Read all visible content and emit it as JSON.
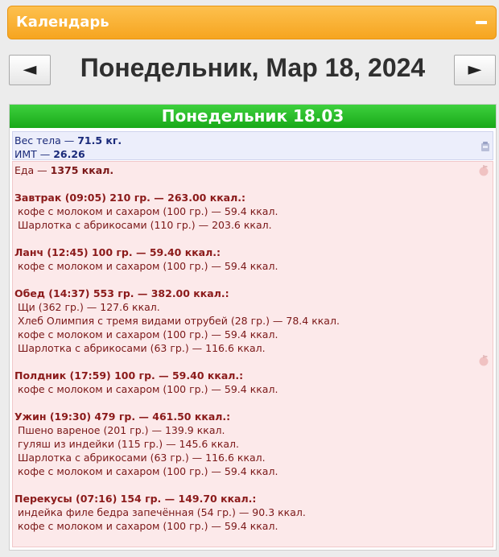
{
  "header": {
    "title": "Календарь",
    "collapse_label": "−"
  },
  "nav": {
    "prev_label": "◄",
    "next_label": "►",
    "date_title": "Понедельник, Мар 18, 2024"
  },
  "day": {
    "label": "Понедельник 18.03"
  },
  "body_stats": {
    "weight_label": "Вес тела — ",
    "weight_value": "71.5 кг.",
    "bmi_label": "ИМТ — ",
    "bmi_value": "26.26"
  },
  "food": {
    "total_label": "Еда — ",
    "total_value": "1375 ккал.",
    "meals": [
      {
        "title": "Завтрак (09:05) 210 гр. — 263.00 ккал.:",
        "items": [
          "кофе с молоком и сахаром (100 гр.) — 59.4 ккал.",
          "Шарлотка с абрикосами (110 гр.) — 203.6 ккал."
        ]
      },
      {
        "title": "Ланч (12:45) 100 гр. — 59.40 ккал.:",
        "items": [
          "кофе с молоком и сахаром (100 гр.) — 59.4 ккал."
        ]
      },
      {
        "title": "Обед (14:37) 553 гр. — 382.00 ккал.:",
        "items": [
          "Щи (362 гр.) — 127.6 ккал.",
          "Хлеб Олимпия с тремя видами отрубей (28 гр.) — 78.4 ккал.",
          "кофе с молоком и сахаром (100 гр.) — 59.4 ккал.",
          "Шарлотка с абрикосами (63 гр.) — 116.6 ккал."
        ]
      },
      {
        "title": "Полдник (17:59) 100 гр. — 59.40 ккал.:",
        "items": [
          "кофе с молоком и сахаром (100 гр.) — 59.4 ккал."
        ]
      },
      {
        "title": "Ужин (19:30) 479 гр. — 461.50 ккал.:",
        "items": [
          "Пшено вареное (201 гр.) — 139.9 ккал.",
          "гуляш из индейки (115 гр.) — 145.6 ккал.",
          "Шарлотка с абрикосами (63 гр.) — 116.6 ккал.",
          "кофе с молоком и сахаром (100 гр.) — 59.4 ккал."
        ]
      },
      {
        "title": "Перекусы (07:16) 154 гр. — 149.70 ккал.:",
        "items": [
          "индейка филе бедра запечённая (54 гр.) — 90.3 ккал.",
          "кофе с молоком и сахаром (100 гр.) — 59.4 ккал."
        ]
      }
    ]
  },
  "icons": {
    "scale": "scale-icon",
    "food": "apple-icon",
    "accent": "#f6a520",
    "green": "#18a818"
  }
}
